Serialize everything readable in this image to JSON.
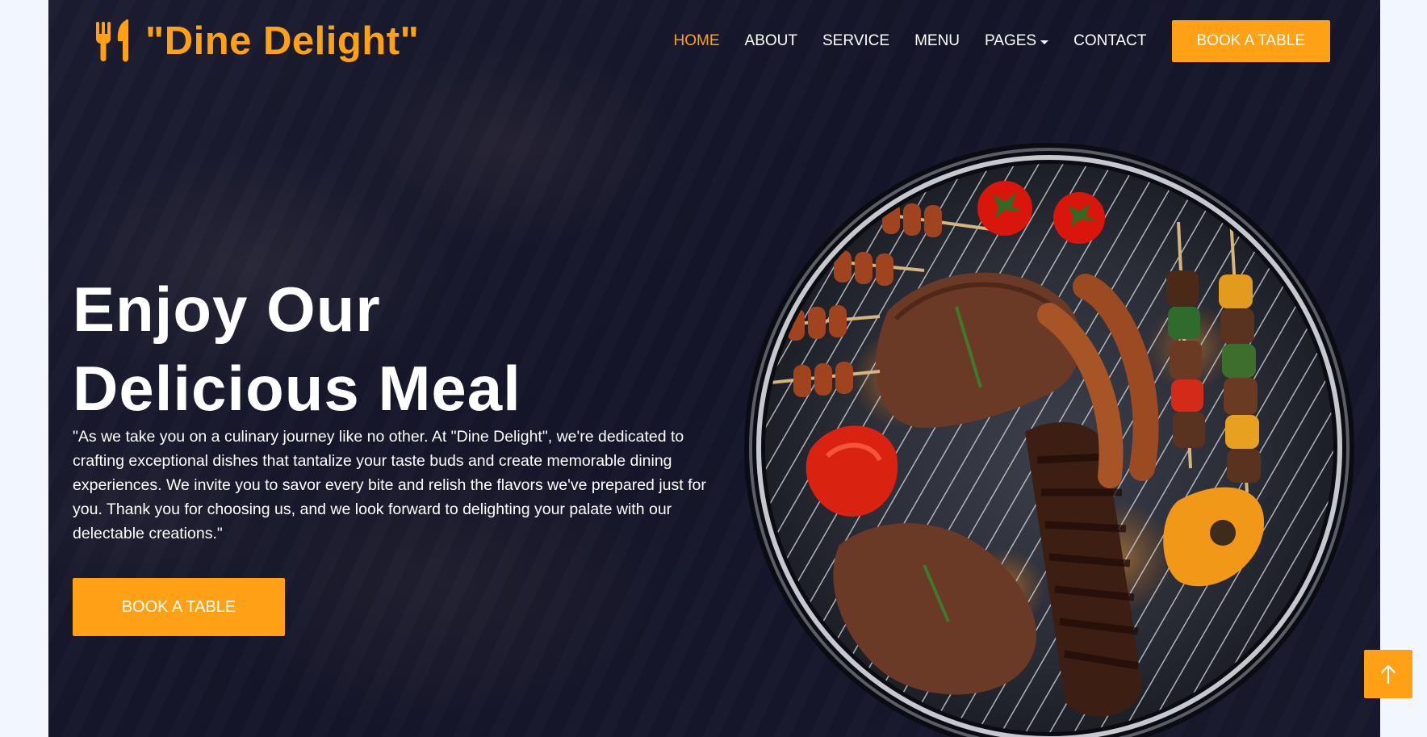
{
  "brand": {
    "name": "\"Dine Delight\"",
    "icon": "utensils-icon"
  },
  "nav": {
    "items": [
      {
        "label": "HOME",
        "active": true
      },
      {
        "label": "ABOUT"
      },
      {
        "label": "SERVICE"
      },
      {
        "label": "MENU"
      },
      {
        "label": "PAGES",
        "dropdown": true
      },
      {
        "label": "CONTACT"
      }
    ],
    "cta_label": "BOOK A TABLE"
  },
  "hero": {
    "headline_line1": "Enjoy Our",
    "headline_line2": "Delicious Meal",
    "lead": "\"As we take you on a culinary journey like no other. At \"Dine Delight\", we're dedicated to crafting exceptional dishes that tantalize your taste buds and create memorable dining experiences. We invite you to savor every bite and relish the flavors we've prepared just for you. Thank you for choosing us, and we look forward to delighting your palate with our delectable creations.\"",
    "cta_label": "BOOK A TABLE",
    "image": "grill-food-image"
  },
  "back_to_top": {
    "icon": "arrow-up-icon"
  },
  "colors": {
    "accent": "#fea116",
    "background": "#161729",
    "page_background": "#f1f7fd",
    "text": "#ffffff"
  }
}
